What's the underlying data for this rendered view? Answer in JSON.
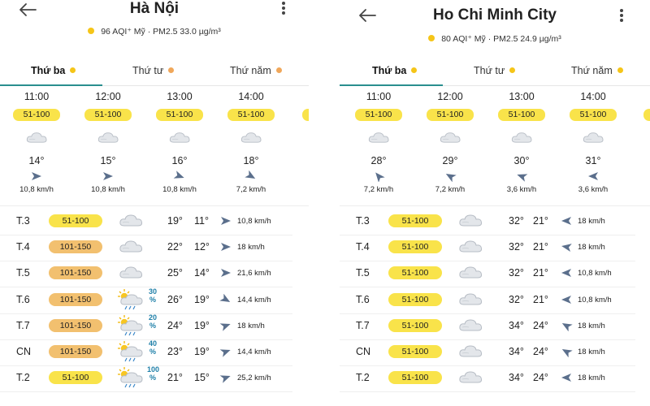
{
  "colors": {
    "good_badge": "#f9e34a",
    "moderate_badge": "#f2c06f",
    "tab_underline": "#2a8f8f",
    "aqi_dot": "#f5c518",
    "dot_orange": "#f0a75a",
    "precip_text": "#1e7fa8",
    "wind_arrow": "#5b6f8c"
  },
  "panels": [
    {
      "title": "Hà Nội",
      "aqi_text": "96 AQI⁺ Mỹ · PM2.5 33.0 µg/m³",
      "tabs": [
        {
          "label": "Thứ ba",
          "dot": "#f5c518",
          "active": true
        },
        {
          "label": "Thứ tư",
          "dot": "#f0a75a",
          "active": false
        },
        {
          "label": "Thứ năm",
          "dot": "#f0a75a",
          "active": false
        }
      ],
      "hours": [
        {
          "time": "11:00",
          "aqi": "51-100",
          "icon": "cloud-icon",
          "temp": "14°",
          "wind_dir": 90,
          "speed": "10,8 km/h"
        },
        {
          "time": "12:00",
          "aqi": "51-100",
          "icon": "cloud-icon",
          "temp": "15°",
          "wind_dir": 90,
          "speed": "10,8 km/h"
        },
        {
          "time": "13:00",
          "aqi": "51-100",
          "icon": "cloud-icon",
          "temp": "16°",
          "wind_dir": 110,
          "speed": "10,8 km/h"
        },
        {
          "time": "14:00",
          "aqi": "51-100",
          "icon": "cloud-icon",
          "temp": "18°",
          "wind_dir": 120,
          "speed": "7,2 km/h"
        }
      ],
      "days": [
        {
          "day": "T.3",
          "aqi": "51-100",
          "level": "good",
          "icon": "cloud-icon",
          "precip": "",
          "hi": "19°",
          "lo": "11°",
          "wind_dir": 90,
          "speed": "10,8 km/h"
        },
        {
          "day": "T.4",
          "aqi": "101-150",
          "level": "moderate",
          "icon": "cloud-icon",
          "precip": "",
          "hi": "22°",
          "lo": "12°",
          "wind_dir": 90,
          "speed": "18 km/h"
        },
        {
          "day": "T.5",
          "aqi": "101-150",
          "level": "moderate",
          "icon": "cloud-icon",
          "precip": "",
          "hi": "25°",
          "lo": "14°",
          "wind_dir": 90,
          "speed": "21,6 km/h"
        },
        {
          "day": "T.6",
          "aqi": "101-150",
          "level": "moderate",
          "icon": "sun-rain-icon",
          "precip": "30 %",
          "hi": "26°",
          "lo": "19°",
          "wind_dir": 120,
          "speed": "14,4 km/h"
        },
        {
          "day": "T.7",
          "aqi": "101-150",
          "level": "moderate",
          "icon": "sun-rain-icon",
          "precip": "20 %",
          "hi": "24°",
          "lo": "19°",
          "wind_dir": 70,
          "speed": "18 km/h"
        },
        {
          "day": "CN",
          "aqi": "101-150",
          "level": "moderate",
          "icon": "sun-rain-icon",
          "precip": "40 %",
          "hi": "23°",
          "lo": "19°",
          "wind_dir": 70,
          "speed": "14,4 km/h"
        },
        {
          "day": "T.2",
          "aqi": "51-100",
          "level": "good",
          "icon": "sun-rain-icon",
          "precip": "100 %",
          "hi": "21°",
          "lo": "15°",
          "wind_dir": 70,
          "speed": "25,2 km/h"
        }
      ]
    },
    {
      "title": "Ho Chi Minh City",
      "aqi_text": "80 AQI⁺ Mỹ · PM2.5 24.9 µg/m³",
      "tabs": [
        {
          "label": "Thứ ba",
          "dot": "#f5c518",
          "active": true
        },
        {
          "label": "Thứ tư",
          "dot": "#f5c518",
          "active": false
        },
        {
          "label": "Thứ năm",
          "dot": "#f5c518",
          "active": false
        }
      ],
      "hours": [
        {
          "time": "11:00",
          "aqi": "51-100",
          "icon": "cloud-icon",
          "temp": "28°",
          "wind_dir": 320,
          "speed": "7,2 km/h"
        },
        {
          "time": "12:00",
          "aqi": "51-100",
          "icon": "cloud-icon",
          "temp": "29°",
          "wind_dir": 300,
          "speed": "7,2 km/h"
        },
        {
          "time": "13:00",
          "aqi": "51-100",
          "icon": "cloud-icon",
          "temp": "30°",
          "wind_dir": 290,
          "speed": "3,6 km/h"
        },
        {
          "time": "14:00",
          "aqi": "51-100",
          "icon": "cloud-icon",
          "temp": "31°",
          "wind_dir": 270,
          "speed": "3,6 km/h"
        }
      ],
      "days": [
        {
          "day": "T.3",
          "aqi": "51-100",
          "level": "good",
          "icon": "cloud-icon",
          "precip": "",
          "hi": "32°",
          "lo": "21°",
          "wind_dir": 270,
          "speed": "18 km/h"
        },
        {
          "day": "T.4",
          "aqi": "51-100",
          "level": "good",
          "icon": "cloud-icon",
          "precip": "",
          "hi": "32°",
          "lo": "21°",
          "wind_dir": 280,
          "speed": "18 km/h"
        },
        {
          "day": "T.5",
          "aqi": "51-100",
          "level": "good",
          "icon": "cloud-icon",
          "precip": "",
          "hi": "32°",
          "lo": "21°",
          "wind_dir": 270,
          "speed": "10,8 km/h"
        },
        {
          "day": "T.6",
          "aqi": "51-100",
          "level": "good",
          "icon": "cloud-icon",
          "precip": "",
          "hi": "32°",
          "lo": "21°",
          "wind_dir": 270,
          "speed": "10,8 km/h"
        },
        {
          "day": "T.7",
          "aqi": "51-100",
          "level": "good",
          "icon": "cloud-icon",
          "precip": "",
          "hi": "34°",
          "lo": "24°",
          "wind_dir": 300,
          "speed": "18 km/h"
        },
        {
          "day": "CN",
          "aqi": "51-100",
          "level": "good",
          "icon": "cloud-icon",
          "precip": "",
          "hi": "34°",
          "lo": "24°",
          "wind_dir": 300,
          "speed": "18 km/h"
        },
        {
          "day": "T.2",
          "aqi": "51-100",
          "level": "good",
          "icon": "cloud-icon",
          "precip": "",
          "hi": "34°",
          "lo": "24°",
          "wind_dir": 270,
          "speed": "18 km/h"
        }
      ]
    }
  ]
}
